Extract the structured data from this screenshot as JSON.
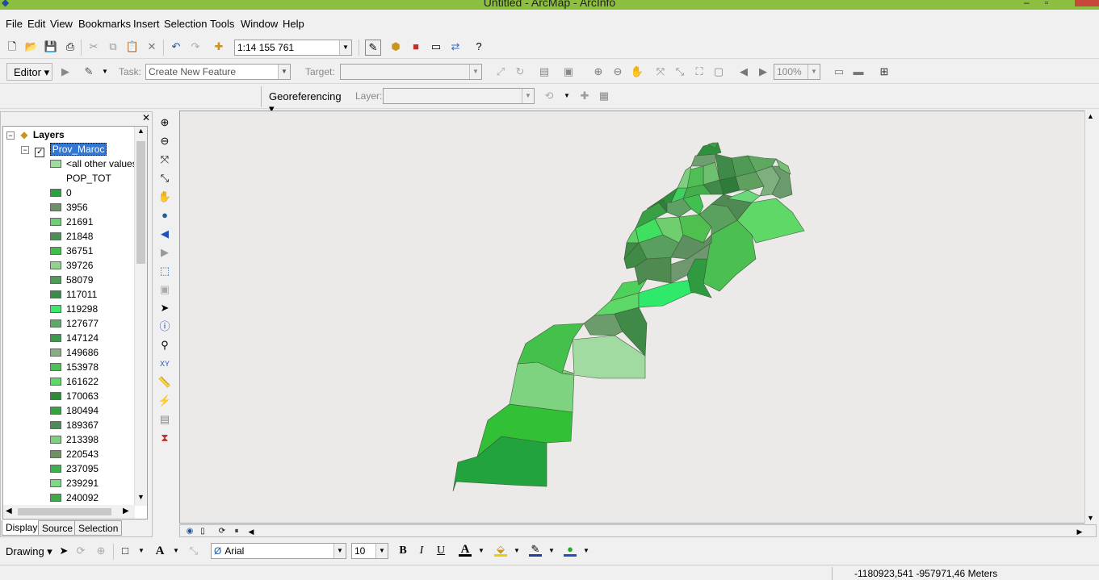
{
  "window": {
    "title": "Untitled - ArcMap - ArcInfo"
  },
  "menu": [
    "File",
    "Edit",
    "View",
    "Bookmarks",
    "Insert",
    "Selection",
    "Tools",
    "Window",
    "Help"
  ],
  "standard_toolbar": {
    "scale": "1:14 155 761"
  },
  "editor_toolbar": {
    "editor_label": "Editor",
    "task_label": "Task:",
    "task_value": "Create New Feature",
    "target_label": "Target:",
    "zoom_value": "100%"
  },
  "georef_toolbar": {
    "label": "Georeferencing",
    "layer_label": "Layer:"
  },
  "toc": {
    "root": "Layers",
    "layer": "Prov_Maroc",
    "other_values": "<all other values>",
    "field": "POP_TOT",
    "classes": [
      {
        "label": "0",
        "color": "#2fa03f"
      },
      {
        "label": "3956",
        "color": "#6f8f6a"
      },
      {
        "label": "21691",
        "color": "#6fcf78"
      },
      {
        "label": "21848",
        "color": "#4b8f55"
      },
      {
        "label": "36751",
        "color": "#3fbf4a"
      },
      {
        "label": "39726",
        "color": "#8fd38f"
      },
      {
        "label": "58079",
        "color": "#4f9a5a"
      },
      {
        "label": "117011",
        "color": "#3a8a4a"
      },
      {
        "label": "119298",
        "color": "#3de86f"
      },
      {
        "label": "127677",
        "color": "#5fa86a"
      },
      {
        "label": "147124",
        "color": "#3f9a4f"
      },
      {
        "label": "149686",
        "color": "#8aaa88"
      },
      {
        "label": "153978",
        "color": "#4fbf5a"
      },
      {
        "label": "161622",
        "color": "#5fd86a"
      },
      {
        "label": "170063",
        "color": "#2f8a3a"
      },
      {
        "label": "180494",
        "color": "#36a33f"
      },
      {
        "label": "189367",
        "color": "#4f8a5a"
      },
      {
        "label": "213398",
        "color": "#7fcf7f"
      },
      {
        "label": "220543",
        "color": "#6f8f66"
      },
      {
        "label": "237095",
        "color": "#3fb050"
      },
      {
        "label": "239291",
        "color": "#7fd88a"
      },
      {
        "label": "240092",
        "color": "#3faa4a"
      }
    ],
    "tabs": [
      "Display",
      "Source",
      "Selection"
    ]
  },
  "drawing_toolbar": {
    "drawing_label": "Drawing",
    "font": "Arial",
    "size": "10",
    "bold": "B",
    "italic": "I",
    "underline": "U",
    "text_tool": "A"
  },
  "status": {
    "coords": "-1180923,541  -957971,46 Meters"
  }
}
